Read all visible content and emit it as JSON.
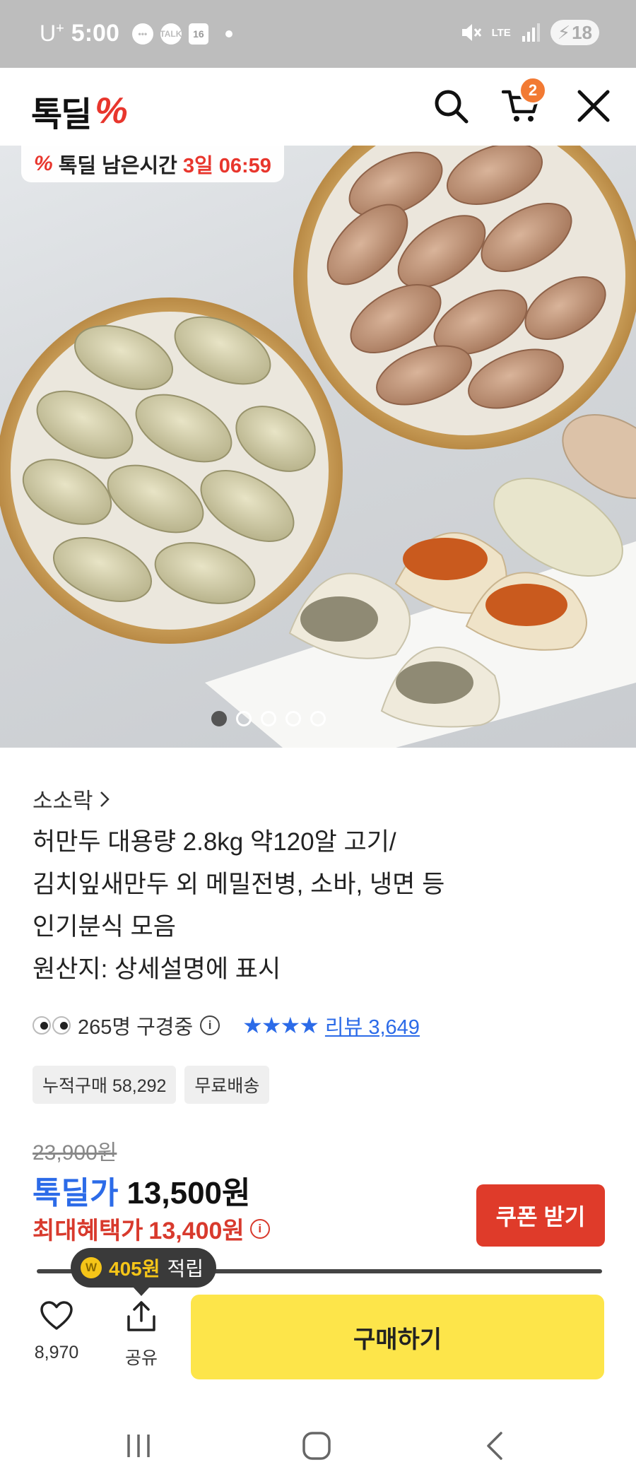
{
  "status_bar": {
    "carrier": "U",
    "carrier_sup": "+",
    "time": "5:00",
    "talk_label": "TALK",
    "calendar_day": "16",
    "network": "LTE",
    "battery": "18"
  },
  "header": {
    "logo_text": "톡딜",
    "logo_mark": "%",
    "cart_count": "2"
  },
  "hero": {
    "timer_label": "톡딜 남은시간",
    "timer_value": "3일 06:59",
    "timer_mark": "%",
    "page_count": 5,
    "active_page": 1
  },
  "product": {
    "brand": "소소락",
    "title_lines": [
      "허만두 대용량 2.8kg 약120알 고기/",
      "김치잎새만두 외 메밀전병, 소바, 냉면 등",
      "인기분식 모음",
      "원산지: 상세설명에 표시"
    ],
    "viewers": "265명 구경중",
    "rating_stars": "★★★★",
    "review_label": "리뷰 3,649",
    "chips": [
      "누적구매 58,292",
      "무료배송"
    ],
    "original_price": "23,900원",
    "deal_label": "톡딜가",
    "deal_price": "13,500원",
    "max_label": "최대혜택가",
    "max_price": "13,400원",
    "coupon_button": "쿠폰 받기"
  },
  "bottom": {
    "reward_amount": "405원",
    "reward_suffix": "적립",
    "coin_symbol": "W",
    "like_count": "8,970",
    "share_label": "공유",
    "buy_button": "구매하기"
  },
  "colors": {
    "brand_red": "#e8362d",
    "deal_blue": "#2c6be8",
    "buy_yellow": "#fde54a",
    "coupon_red": "#df3b2a",
    "cart_badge": "#f27a33"
  }
}
